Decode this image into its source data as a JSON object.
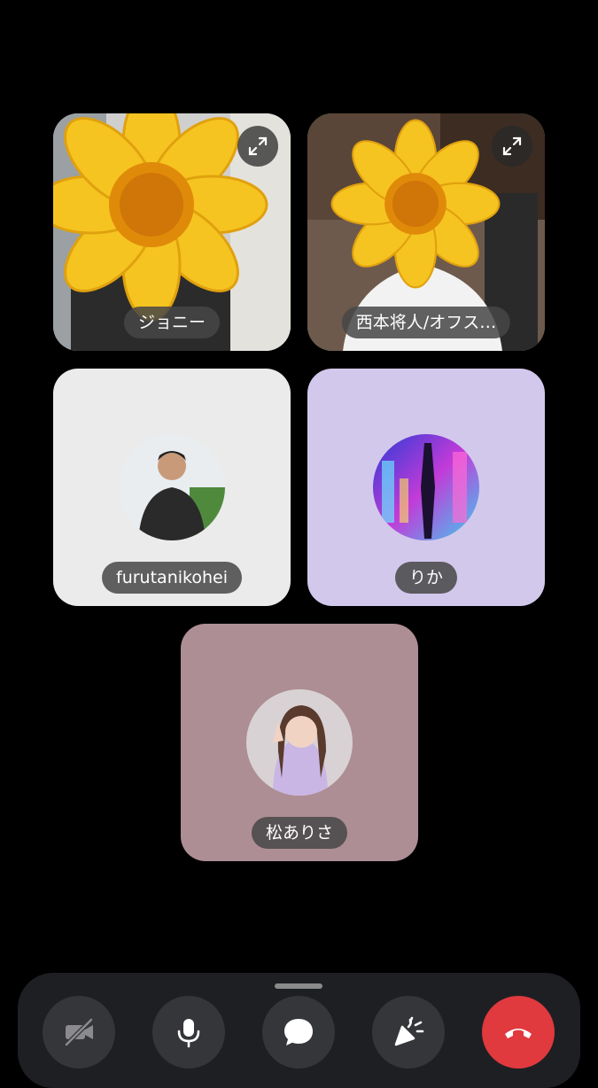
{
  "participants": [
    {
      "name": "ジョニー",
      "type": "video",
      "active": false
    },
    {
      "name": "西本将人/オフス…",
      "type": "video",
      "active": true
    },
    {
      "name": "furutanikohei",
      "type": "avatar",
      "tile_color": "#ebebeb"
    },
    {
      "name": "りか",
      "type": "avatar",
      "tile_color": "#d2c8ec"
    },
    {
      "name": "松ありさ",
      "type": "avatar",
      "tile_color": "#ad8e94"
    }
  ],
  "toolbar": {
    "buttons": [
      {
        "icon": "camera-off-icon"
      },
      {
        "icon": "microphone-icon"
      },
      {
        "icon": "chat-bubble-icon"
      },
      {
        "icon": "party-popper-icon"
      },
      {
        "icon": "end-call-icon"
      }
    ]
  },
  "colors": {
    "active_border": "#2fa84f",
    "end_call": "#e0393e"
  }
}
